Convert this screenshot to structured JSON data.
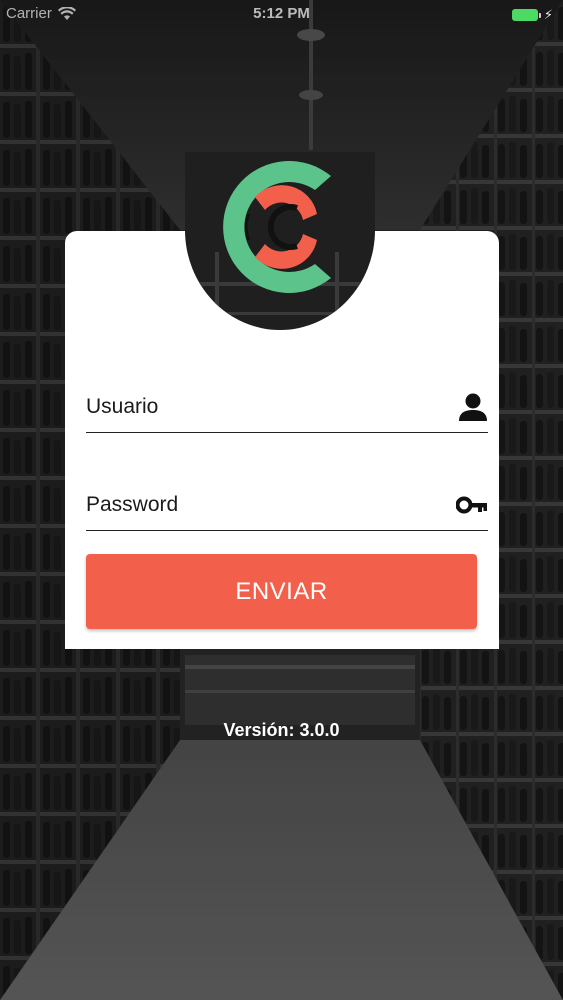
{
  "status_bar": {
    "carrier": "Carrier",
    "time": "5:12 PM",
    "battery_color": "#4cd964"
  },
  "login": {
    "username_placeholder": "Usuario",
    "password_placeholder": "Password",
    "submit_label": "ENVIAR",
    "username_icon": "user-icon",
    "password_icon": "key-icon"
  },
  "footer": {
    "version": "Versión: 3.0.0"
  },
  "colors": {
    "accent": "#f2604b",
    "logo_green": "#5cc48a",
    "logo_red": "#f2604b"
  }
}
